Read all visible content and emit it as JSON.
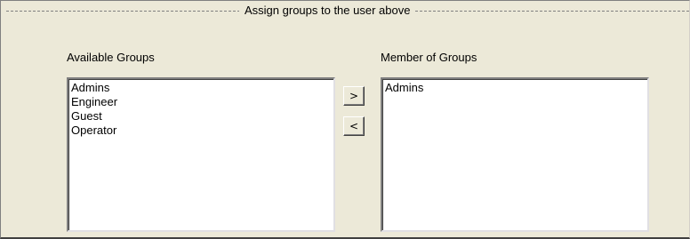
{
  "group": {
    "title": "Assign groups to the user above"
  },
  "available": {
    "label": "Available Groups",
    "items": [
      "Admins",
      "Engineer",
      "Guest",
      "Operator"
    ]
  },
  "member": {
    "label": "Member of Groups",
    "items": [
      "Admins"
    ]
  },
  "buttons": {
    "add_label": ">",
    "remove_label": "<"
  },
  "colors": {
    "panel_background": "#ece9d8",
    "list_background": "#ffffff"
  }
}
